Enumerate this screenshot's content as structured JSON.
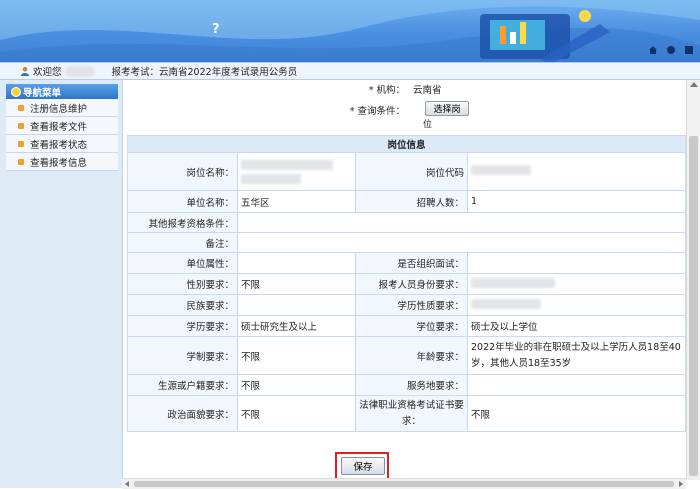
{
  "banner": {
    "logo_glyph": "?"
  },
  "welcome": {
    "prefix": "欢迎您",
    "breadcrumb": "报考考试：云南省2022年度考试录用公务员"
  },
  "sidebar": {
    "header": "导航菜单",
    "items": [
      {
        "label": "注册信息维护"
      },
      {
        "label": "查看报考文件"
      },
      {
        "label": "查看报考状态"
      },
      {
        "label": "查看报考信息"
      }
    ]
  },
  "form": {
    "org_label": "* 机构：",
    "org_value": "云南省",
    "query_label": "* 查询条件：",
    "select_button": "选择岗",
    "select_button_line2": "位"
  },
  "table": {
    "title": "岗位信息",
    "rows": [
      {
        "k1": "岗位名称：",
        "v1": "",
        "k2": "岗位代码",
        "v2": ""
      },
      {
        "k1": "单位名称：",
        "v1": "五华区",
        "k2": "招聘人数：",
        "v2": "1"
      },
      {
        "k1": "其他报考资格条件：",
        "v1": "",
        "k2": "",
        "v2": ""
      },
      {
        "k1": "备注：",
        "v1": "",
        "k2": "",
        "v2": ""
      },
      {
        "k1": "单位属性：",
        "v1": "",
        "k2": "是否组织面试：",
        "v2": ""
      },
      {
        "k1": "性别要求：",
        "v1": "不限",
        "k2": "报考人员身份要求：",
        "v2": ""
      },
      {
        "k1": "民族要求：",
        "v1": "",
        "k2": "学历性质要求：",
        "v2": ""
      },
      {
        "k1": "学历要求：",
        "v1": "硕士研究生及以上",
        "k2": "学位要求：",
        "v2": "硕士及以上学位"
      },
      {
        "k1": "学制要求：",
        "v1": "不限",
        "k2": "年龄要求：",
        "v2": "2022年毕业的非在职硕士及以上学历人员18至40岁，其他人员18至35岁"
      },
      {
        "k1": "生源或户籍要求：",
        "v1": "不限",
        "k2": "服务地要求：",
        "v2": ""
      },
      {
        "k1": "政治面貌要求：",
        "v1": "不限",
        "k2": "法律职业资格考试证书要求：",
        "v2": "不限"
      }
    ]
  },
  "save_button": "保存"
}
